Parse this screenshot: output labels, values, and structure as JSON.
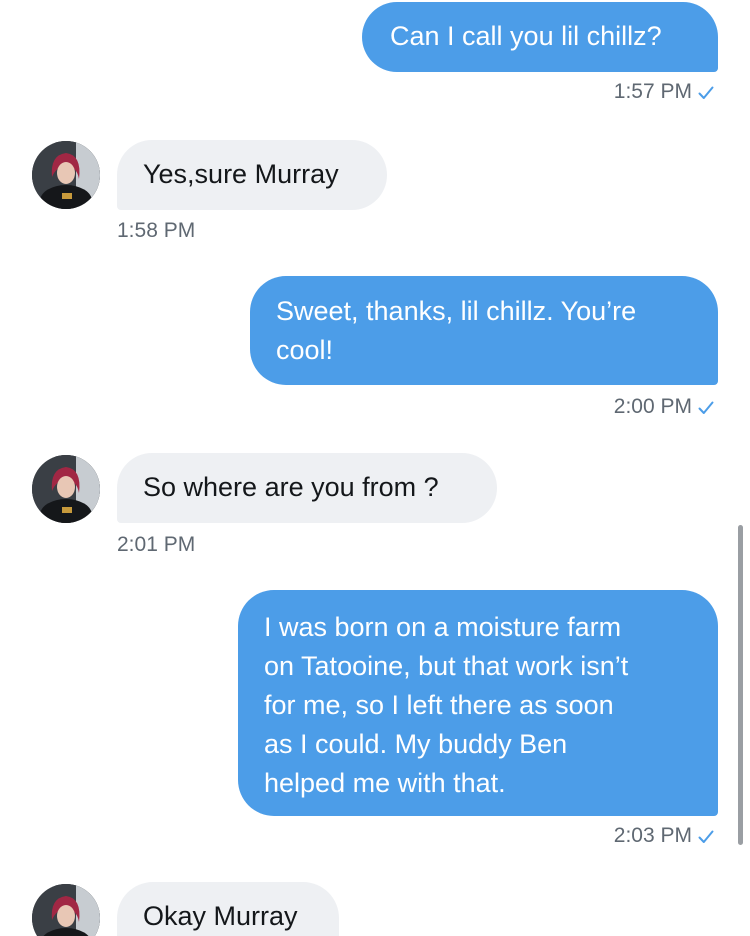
{
  "messages": [
    {
      "direction": "out",
      "text": "Can I call you lil chillz?",
      "time": "1:57 PM"
    },
    {
      "direction": "in",
      "text": "Yes,sure Murray",
      "time": "1:58 PM"
    },
    {
      "direction": "out",
      "text": "Sweet, thanks, lil chillz. You’re\ncool!",
      "time": "2:00 PM"
    },
    {
      "direction": "in",
      "text": "So where are you from ?",
      "time": "2:01 PM"
    },
    {
      "direction": "out",
      "text": "I was born on a moisture farm\non Tatooine, but that work isn’t\nfor me, so I left there as soon\nas I could. My buddy Ben\nhelped me with that.",
      "time": "2:03 PM"
    },
    {
      "direction": "in",
      "text": "Okay Murray"
    }
  ],
  "icons": {
    "read_receipt": "check-icon",
    "contact_avatar": "avatar"
  },
  "colors": {
    "outgoing_bubble": "#4c9de8",
    "incoming_bubble": "#eef0f3",
    "timestamp": "#5f6872",
    "read_check": "#4c9de8"
  }
}
